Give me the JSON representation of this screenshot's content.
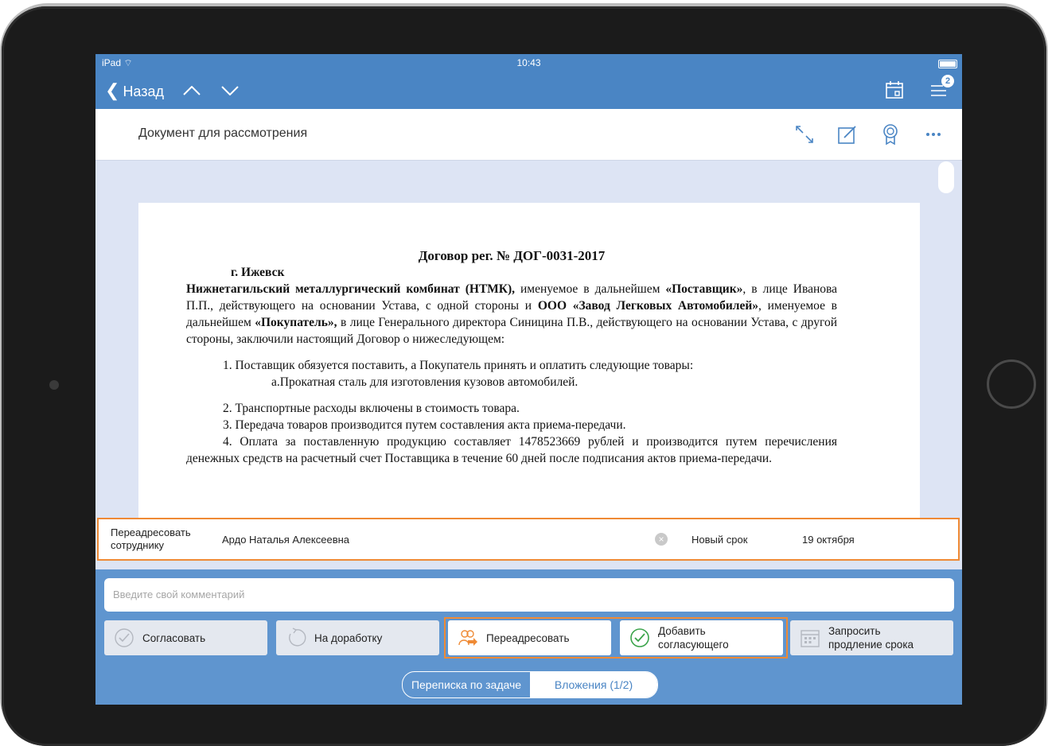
{
  "status_bar": {
    "device": "iPad",
    "time": "10:43"
  },
  "nav": {
    "back_label": "Назад",
    "notification_count": "2"
  },
  "title_bar": {
    "title": "Документ для рассмотрения"
  },
  "document": {
    "heading": "Договор рег. № ДОГ-0031-2017",
    "city": "г. Ижевск",
    "p1_b1": "Нижнетагильский металлургический комбинат (НТМК),",
    "p1_t1": " именуемое в дальнейшем ",
    "p1_b2": "«Поставщик»",
    "p1_t2": ", в лице Иванова П.П., действующего на основании Устава, с одной стороны и ",
    "p1_b3": "ООО «Завод Легковых Автомобилей»",
    "p1_t3": ", именуемое в дальнейшем ",
    "p1_b4": "«Покупатель»,",
    "p1_t4": " в лице Генерального директора Синицина П.В., действующего на основании Устава, с другой стороны, заключили настоящий Договор о нижеследующем:",
    "item1": "1.   Поставщик обязуется поставить, а Покупатель принять и оплатить следующие товары:",
    "item1a": "а.Прокатная сталь для изготовления кузовов автомобилей.",
    "item2": "2. Транспортные расходы включены в стоимость товара.",
    "item3": "3. Передача товаров производится путем составления акта приема-передачи.",
    "item4": "4. Оплата за поставленную продукцию составляет 1478523669 рублей и производится путем перечисления денежных средств на расчетный счет Поставщика в течение 60 дней после подписания актов приема-передачи."
  },
  "redirect_panel": {
    "label_line1": "Переадресовать",
    "label_line2": "сотруднику",
    "person": "Ардо Наталья Алексеевна",
    "deadline_label": "Новый срок",
    "deadline_value": "19 октября"
  },
  "comment": {
    "placeholder": "Введите свой комментарий"
  },
  "actions": {
    "approve": "Согласовать",
    "rework": "На доработку",
    "redirect": "Переадресовать",
    "add_approver_line1": "Добавить",
    "add_approver_line2": "согласующего",
    "extend_line1": "Запросить",
    "extend_line2": "продление срока"
  },
  "tabs": {
    "correspondence": "Переписка по задаче",
    "attachments": "Вложения (1/2)"
  },
  "colors": {
    "brand": "#4a85c4",
    "highlight": "#ef8a35",
    "toolbar": "#5f95cf"
  }
}
